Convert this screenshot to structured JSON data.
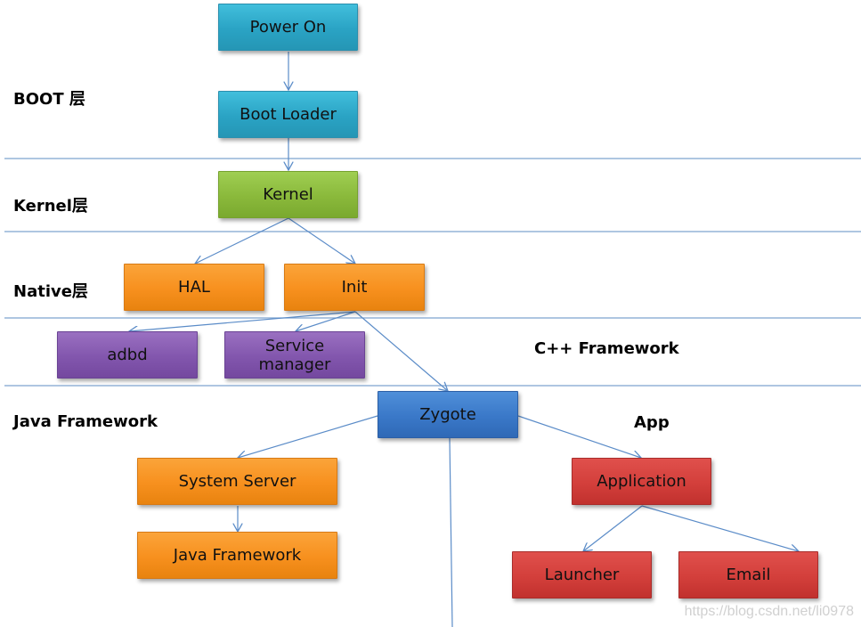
{
  "layers": {
    "boot": "BOOT 层",
    "kernel": "Kernel层",
    "native": "Native层",
    "cpp_framework": "C++ Framework",
    "java_framework": "Java Framework",
    "app": "App"
  },
  "nodes": {
    "power_on": "Power On",
    "boot_loader": "Boot Loader",
    "kernel": "Kernel",
    "hal": "HAL",
    "init": "Init",
    "adbd": "adbd",
    "service_manager_line1": "Service",
    "service_manager_line2": "manager",
    "zygote": "Zygote",
    "system_server": "System Server",
    "java_framework": "Java Framework",
    "application": "Application",
    "launcher": "Launcher",
    "email": "Email"
  },
  "edges": [
    [
      "power_on",
      "boot_loader"
    ],
    [
      "boot_loader",
      "kernel"
    ],
    [
      "kernel",
      "hal"
    ],
    [
      "kernel",
      "init"
    ],
    [
      "init",
      "adbd"
    ],
    [
      "init",
      "service_manager"
    ],
    [
      "init",
      "zygote"
    ],
    [
      "zygote",
      "system_server"
    ],
    [
      "zygote",
      "application"
    ],
    [
      "system_server",
      "java_framework"
    ],
    [
      "application",
      "launcher"
    ],
    [
      "application",
      "email"
    ]
  ],
  "colors": {
    "boot": "#2aa3c4",
    "kernel": "#8ab93b",
    "native": "#f7901e",
    "cpp": "#8256ad",
    "zygote": "#3a78c8",
    "app": "#d33f3b",
    "connector": "#5b8cc8"
  },
  "watermark": "https://blog.csdn.net/li0978"
}
